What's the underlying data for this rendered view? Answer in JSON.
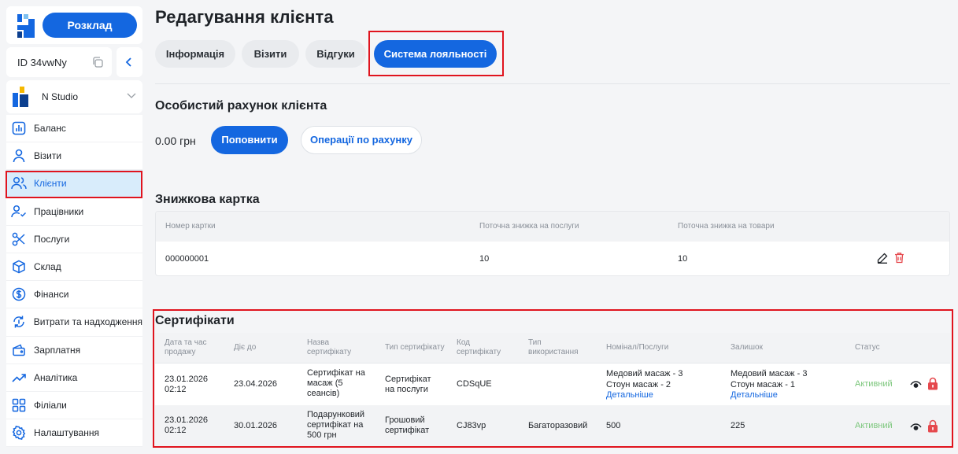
{
  "sidebar": {
    "schedule_label": "Розклад",
    "id_text": "ID 34vwNy",
    "studio_name": "N Studio",
    "items": [
      {
        "label": "Баланс",
        "icon": "chart-bar-icon"
      },
      {
        "label": "Візити",
        "icon": "user-icon"
      },
      {
        "label": "Клієнти",
        "icon": "users-icon",
        "active": true
      },
      {
        "label": "Працівники",
        "icon": "user-check-icon"
      },
      {
        "label": "Послуги",
        "icon": "scissors-icon"
      },
      {
        "label": "Склад",
        "icon": "box-icon"
      },
      {
        "label": "Фінанси",
        "icon": "dollar-circle-icon"
      },
      {
        "label": "Витрати та надходження",
        "icon": "money-exchange-icon"
      },
      {
        "label": "Зарплатня",
        "icon": "wallet-icon"
      },
      {
        "label": "Аналітика",
        "icon": "trend-icon"
      },
      {
        "label": "Філіали",
        "icon": "grid-icon"
      },
      {
        "label": "Налаштування",
        "icon": "gear-icon"
      }
    ]
  },
  "page": {
    "title": "Редагування клієнта",
    "tabs": [
      {
        "label": "Інформація"
      },
      {
        "label": "Візити"
      },
      {
        "label": "Відгуки"
      },
      {
        "label": "Система лояльності",
        "active": true
      }
    ]
  },
  "account": {
    "title": "Особистий рахунок клієнта",
    "balance": "0.00 грн",
    "topup_label": "Поповнити",
    "operations_label": "Операції по рахунку"
  },
  "discount": {
    "title": "Знижкова картка",
    "headers": [
      "Номер картки",
      "Поточна знижка на послуги",
      "Поточна знижка на товари"
    ],
    "row": [
      "000000001",
      "10",
      "10"
    ]
  },
  "certificates": {
    "title": "Сертифікати",
    "headers": [
      "Дата та час продажу",
      "Діє до",
      "Назва сертифікату",
      "Тип сертифікату",
      "Код сертифікату",
      "Тип використання",
      "Номінал/Послуги",
      "Залишок",
      "Статус"
    ],
    "rows": [
      {
        "sold": "23.01.2026 02:12",
        "valid_to": "23.04.2026",
        "name": "Сертифікат на масаж (5 сеансів)",
        "type": "Сертифікат на послуги",
        "code": "CDSqUE",
        "usage": "",
        "nominal_l1": "Медовий масаж - 3",
        "nominal_l2": "Стоун масаж - 2",
        "nominal_link": "Детальніше",
        "rest_l1": "Медовий масаж - 3",
        "rest_l2": "Стоун масаж - 1",
        "rest_link": "Детальніше",
        "status": "Активний"
      },
      {
        "sold": "23.01.2026 02:12",
        "valid_to": "30.01.2026",
        "name": "Подарунковий сертифікат на 500 грн",
        "type": "Грошовий сертифікат",
        "code": "CJ83vp",
        "usage": "Багаторазовий",
        "nominal_l1": "500",
        "rest_l1": "225",
        "status": "Активний"
      }
    ]
  },
  "colors": {
    "accent": "#1467e0",
    "highlight": "#e0141e",
    "status_active": "#7bc67b",
    "delete": "#e5484d"
  }
}
